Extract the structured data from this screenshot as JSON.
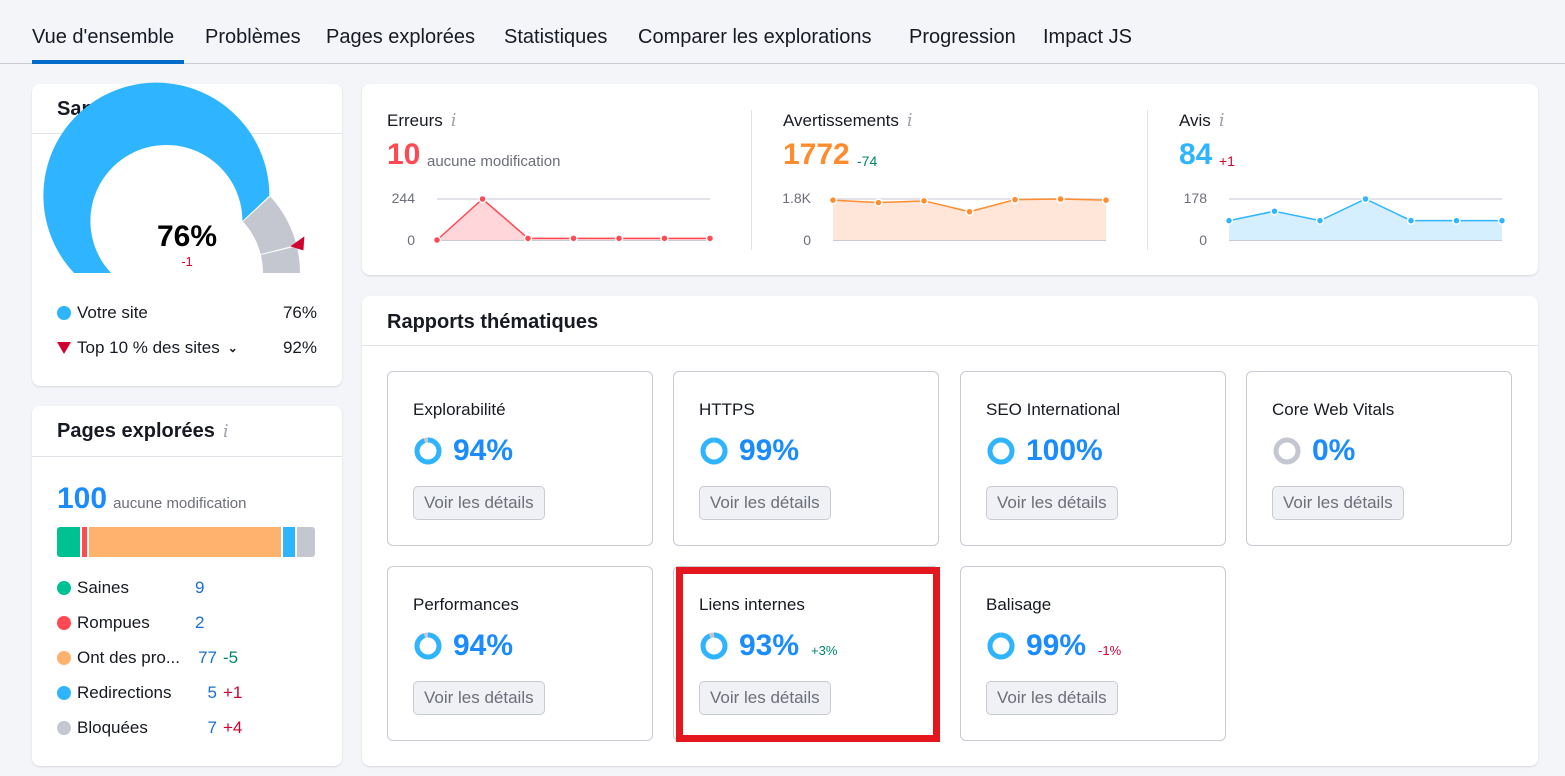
{
  "tabs": [
    {
      "label": "Vue d'ensemble",
      "active": true
    },
    {
      "label": "Problèmes"
    },
    {
      "label": "Pages explorées"
    },
    {
      "label": "Statistiques"
    },
    {
      "label": "Comparer les explorations"
    },
    {
      "label": "Progression"
    },
    {
      "label": "Impact JS"
    }
  ],
  "site_health": {
    "title": "Santé du site",
    "value": "76%",
    "delta": "-1",
    "score_percent": 76,
    "top10_percent": 92,
    "legend": [
      {
        "label": "Votre site",
        "value": "76%",
        "color": "#2fb5ff"
      },
      {
        "label": "Top 10 % des sites",
        "value": "92%",
        "color": "#d1002f"
      }
    ]
  },
  "crawled_pages": {
    "title": "Pages explorées",
    "total": "100",
    "total_note": "aucune modification",
    "categories": [
      {
        "label": "Saines",
        "value": "9",
        "delta": "",
        "color": "#00c192",
        "count": 9
      },
      {
        "label": "Rompues",
        "value": "2",
        "delta": "",
        "color": "#ff4953",
        "count": 2
      },
      {
        "label": "Ont des pro...",
        "value": "77",
        "delta": "-5",
        "delta_type": "green",
        "color": "#ffb26e",
        "count": 77
      },
      {
        "label": "Redirections",
        "value": "5",
        "delta": "+1",
        "delta_type": "red",
        "color": "#2fb5ff",
        "count": 5
      },
      {
        "label": "Bloquées",
        "value": "7",
        "delta": "+4",
        "delta_type": "red",
        "color": "#c4c7cf",
        "count": 7
      }
    ]
  },
  "metrics": [
    {
      "label": "Erreurs",
      "value": "10",
      "delta": "aucune modification",
      "delta_type": "muted",
      "color": "#ff4953",
      "fill": "#ffd6d9",
      "y_max_label": "244",
      "y_min_label": "0",
      "y_max": 244,
      "series": [
        0,
        244,
        10,
        10,
        10,
        10,
        10
      ]
    },
    {
      "label": "Avertissements",
      "value": "1772",
      "delta": "-74",
      "delta_type": "green",
      "color": "#ff8c2e",
      "fill": "#ffe6d9",
      "y_max_label": "1.8K",
      "y_min_label": "0",
      "y_max": 1800,
      "series": [
        1750,
        1640,
        1720,
        1240,
        1770,
        1800,
        1750
      ]
    },
    {
      "label": "Avis",
      "value": "84",
      "delta": "+1",
      "delta_type": "red",
      "color": "#2fb5ff",
      "fill": "#d6efff",
      "y_max_label": "178",
      "y_min_label": "0",
      "y_max": 178,
      "series": [
        84,
        125,
        84,
        178,
        84,
        84,
        84
      ]
    }
  ],
  "reports": {
    "title": "Rapports thématiques",
    "button_label": "Voir les détails",
    "items": [
      {
        "name": "Explorabilité",
        "value": "94%",
        "percent": 94,
        "delta": ""
      },
      {
        "name": "HTTPS",
        "value": "99%",
        "percent": 99,
        "delta": ""
      },
      {
        "name": "SEO International",
        "value": "100%",
        "percent": 100,
        "delta": ""
      },
      {
        "name": "Core Web Vitals",
        "value": "0%",
        "percent": 0,
        "delta": ""
      },
      {
        "name": "Performances",
        "value": "94%",
        "percent": 94,
        "delta": ""
      },
      {
        "name": "Liens internes",
        "value": "93%",
        "percent": 93,
        "delta": "+3%",
        "delta_type": "green"
      },
      {
        "name": "Balisage",
        "value": "99%",
        "percent": 99,
        "delta": "-1%",
        "delta_type": "red"
      }
    ]
  }
}
